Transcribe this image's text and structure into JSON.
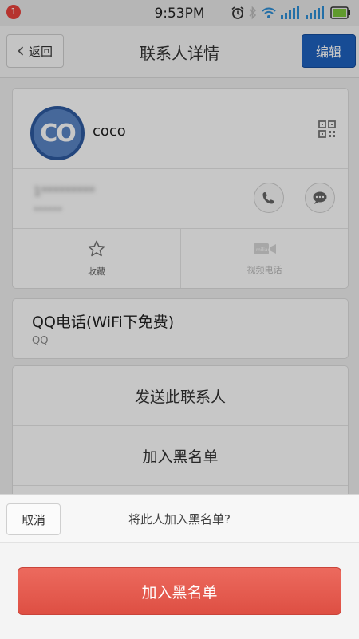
{
  "status_bar": {
    "notification_count": "1",
    "time": "9:53PM",
    "icons": [
      "alarm-icon",
      "bluetooth-icon",
      "wifi-icon",
      "signal-icon",
      "data-signal-icon",
      "battery-icon"
    ]
  },
  "header": {
    "back_label": "返回",
    "title": "联系人详情",
    "edit_label": "编辑"
  },
  "contact": {
    "avatar_text": "CO",
    "name": "coco",
    "phone_number": "1*********",
    "phone_location": "******",
    "favorite_label": "收藏",
    "video_call_label": "视频电话"
  },
  "qq": {
    "title": "QQ电话(WiFi下免费)",
    "subtitle": "QQ"
  },
  "actions": {
    "send_contact": "发送此联系人",
    "add_blacklist": "加入黑名单"
  },
  "dialog": {
    "cancel_label": "取消",
    "question": "将此人加入黑名单?",
    "confirm_label": "加入黑名单"
  },
  "colors": {
    "accent_blue": "#1e62bf",
    "danger_red": "#e55a4e",
    "notification_red": "#e9423b"
  }
}
